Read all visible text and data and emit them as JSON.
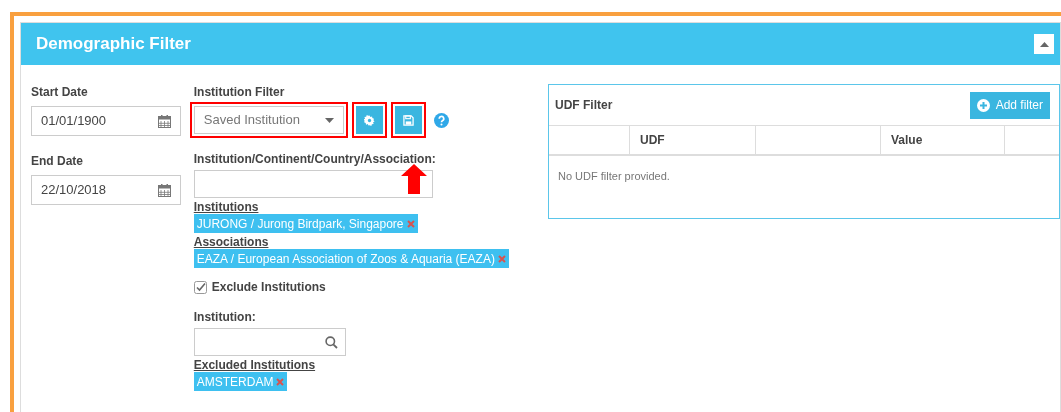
{
  "panel": {
    "title": "Demographic Filter",
    "collapsed": false
  },
  "start_date": {
    "label": "Start Date",
    "value": "01/01/1900"
  },
  "end_date": {
    "label": "End Date",
    "value": "22/10/2018"
  },
  "institution_filter": {
    "label": "Institution Filter",
    "value": "Saved Institution",
    "highlighted": true
  },
  "tool_buttons": [
    {
      "kind": "settings",
      "highlighted": true
    },
    {
      "kind": "save",
      "highlighted": true
    }
  ],
  "search": {
    "label": "Institution/Continent/Country/Association:"
  },
  "groups": [
    {
      "heading": "Institutions",
      "tags": [
        "JURONG / Jurong Birdpark, Singapore"
      ]
    },
    {
      "heading": "Associations",
      "tags": [
        "EAZA / European Association of Zoos & Aquaria (EAZA)"
      ]
    }
  ],
  "exclude": {
    "label": "Exclude Institutions",
    "checked": true
  },
  "institution_search": {
    "label": "Institution:"
  },
  "excluded": {
    "heading": "Excluded Institutions",
    "tags": [
      "AMSTERDAM"
    ]
  },
  "udf": {
    "title": "UDF Filter",
    "add_button": "Add filter",
    "columns": [
      {
        "kind": "blank"
      },
      {
        "kind": "text",
        "label": "UDF"
      },
      {
        "kind": "blank"
      },
      {
        "kind": "text",
        "label": "Value"
      },
      {
        "kind": "blank"
      }
    ],
    "empty_message": "No UDF filter provided."
  }
}
